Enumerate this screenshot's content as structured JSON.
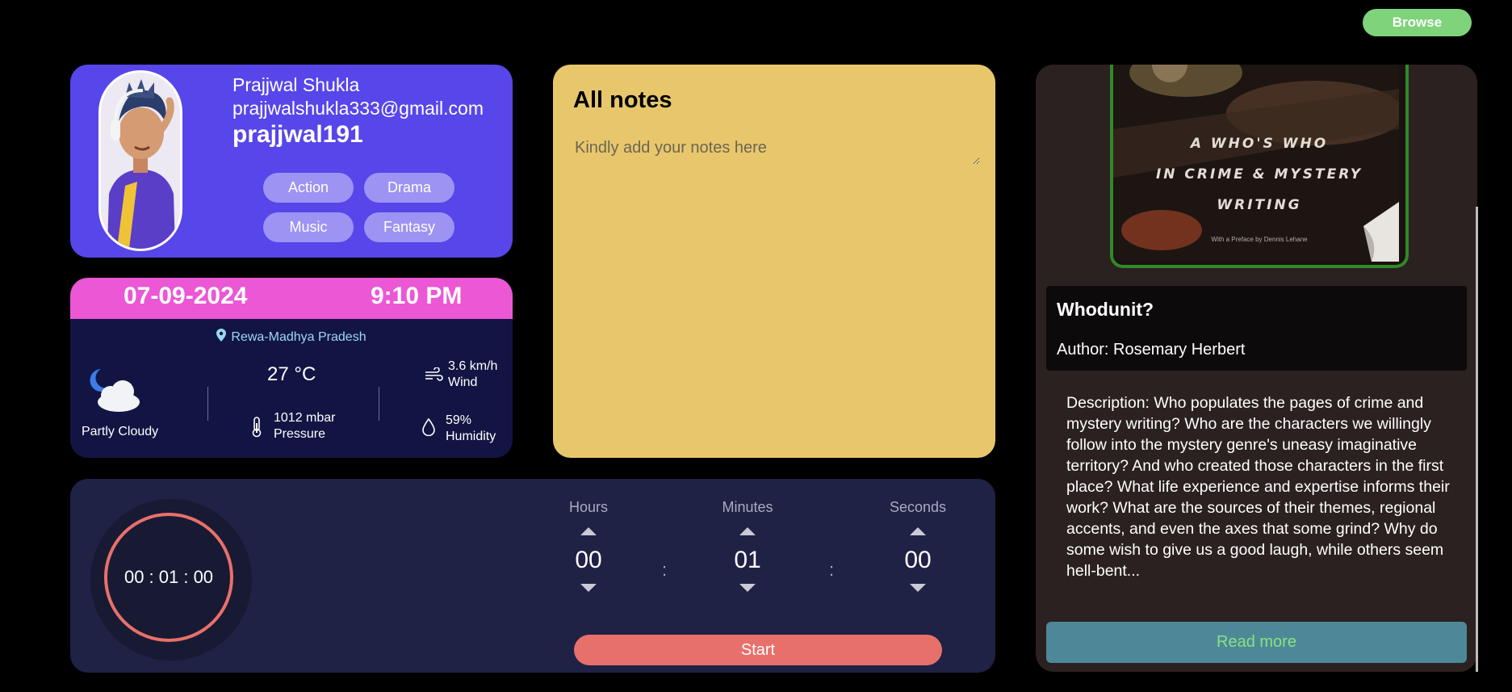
{
  "header": {
    "browse_label": "Browse"
  },
  "profile": {
    "name": "Prajjwal Shukla",
    "email": "prajjwalshukla333@gmail.com",
    "username": "prajjwal191",
    "genres": [
      "Action",
      "Drama",
      "Music",
      "Fantasy"
    ]
  },
  "weather": {
    "date": "07-09-2024",
    "time": "9:10 PM",
    "location": "Rewa-Madhya Pradesh",
    "condition": "Partly Cloudy",
    "temperature": "27 °C",
    "pressure_value": "1012 mbar",
    "pressure_label": "Pressure",
    "wind_value": "3.6 km/h",
    "wind_label": "Wind",
    "humidity_value": "59%",
    "humidity_label": "Humidity"
  },
  "notes": {
    "title": "All notes",
    "placeholder": "Kindly add your notes here"
  },
  "timer": {
    "display": "00 : 01 : 00",
    "hours_label": "Hours",
    "minutes_label": "Minutes",
    "seconds_label": "Seconds",
    "hours": "00",
    "minutes": "01",
    "seconds": "00",
    "separator": ":",
    "start_label": "Start"
  },
  "book": {
    "cover_lines": [
      "A WHO'S WHO",
      "IN CRIME & MYSTERY",
      "WRITING"
    ],
    "cover_subtitle": "With a Preface by Dennis Lehane",
    "title": "Whodunit?",
    "author": "Author: Rosemary Herbert",
    "description": "Description: Who populates the pages of crime and mystery writing? Who are the characters we willingly follow into the mystery genre's uneasy imaginative territory? And who created those characters in the first place? What life experience and expertise informs their work? What are the sources of their themes, regional accents, and even the axes that some grind? Why do some wish to give us a good laugh, while others seem hell-bent...",
    "read_more_label": "Read more"
  },
  "colors": {
    "profile_bg": "#5746ea",
    "weather_header": "#eb57d4",
    "notes_bg": "#e8c76c",
    "timer_accent": "#e8706b",
    "browse_green": "#7fd37a",
    "read_more_bg": "#4e8898"
  }
}
